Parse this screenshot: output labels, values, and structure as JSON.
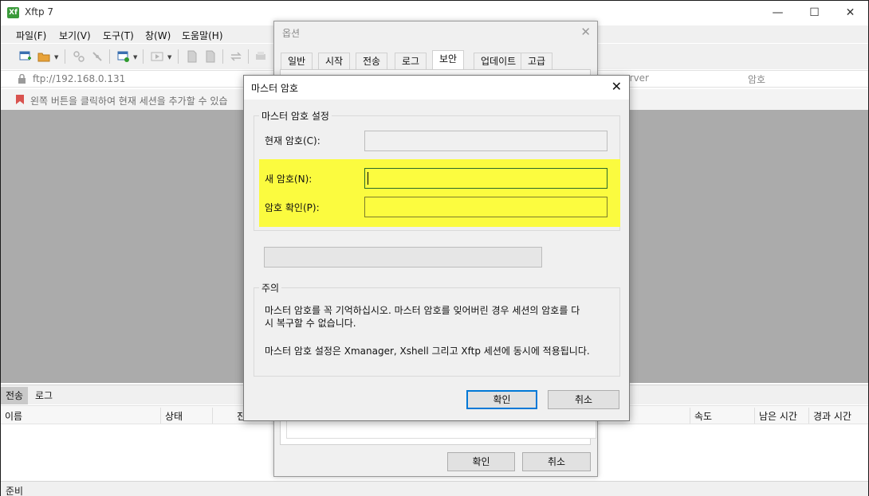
{
  "app": {
    "title": "Xftp 7",
    "logo": "Xf",
    "window_controls": [
      "—",
      "☐",
      "✕"
    ]
  },
  "menu": [
    "파일(F)",
    "보기(V)",
    "도구(T)",
    "창(W)",
    "도움말(H)"
  ],
  "address": {
    "text": "ftp://192.168.0.131"
  },
  "hint": {
    "text": "왼쪽 버튼을 클릭하여 현재 세션을 추가할 수 있습"
  },
  "right_columns": [
    "server",
    "암호"
  ],
  "bottom": {
    "tabs": [
      "전송",
      "로그"
    ],
    "columns": [
      "이름",
      "상태",
      "진",
      "속도",
      "남은 시간",
      "경과 시간"
    ],
    "status": "준비"
  },
  "options_dialog": {
    "title": "옵션",
    "tabs": [
      "일반",
      "시작",
      "전송",
      "로그",
      "보안",
      "업데이트",
      "고급"
    ],
    "active_tab": "보안",
    "ok_label": "확인",
    "cancel_label": "취소"
  },
  "master_dialog": {
    "title": "마스터 암호",
    "settings_group": "마스터 암호 설정",
    "current_label": "현재 암호(C):",
    "new_label": "새 암호(N):",
    "confirm_label": "암호 확인(P):",
    "notice_group": "주의",
    "notice_line1": "마스터 암호를 꼭 기억하십시오.  마스터 암호를 잊어버린 경우 세션의 암호를 다",
    "notice_line2": "시 복구할 수 없습니다.",
    "notice_line3": "마스터 암호 설정은 Xmanager, Xshell 그리고 Xftp 세션에 동시에 적용됩니다.",
    "ok_label": "확인",
    "cancel_label": "취소",
    "highlight_color": "#fbfb3f"
  }
}
